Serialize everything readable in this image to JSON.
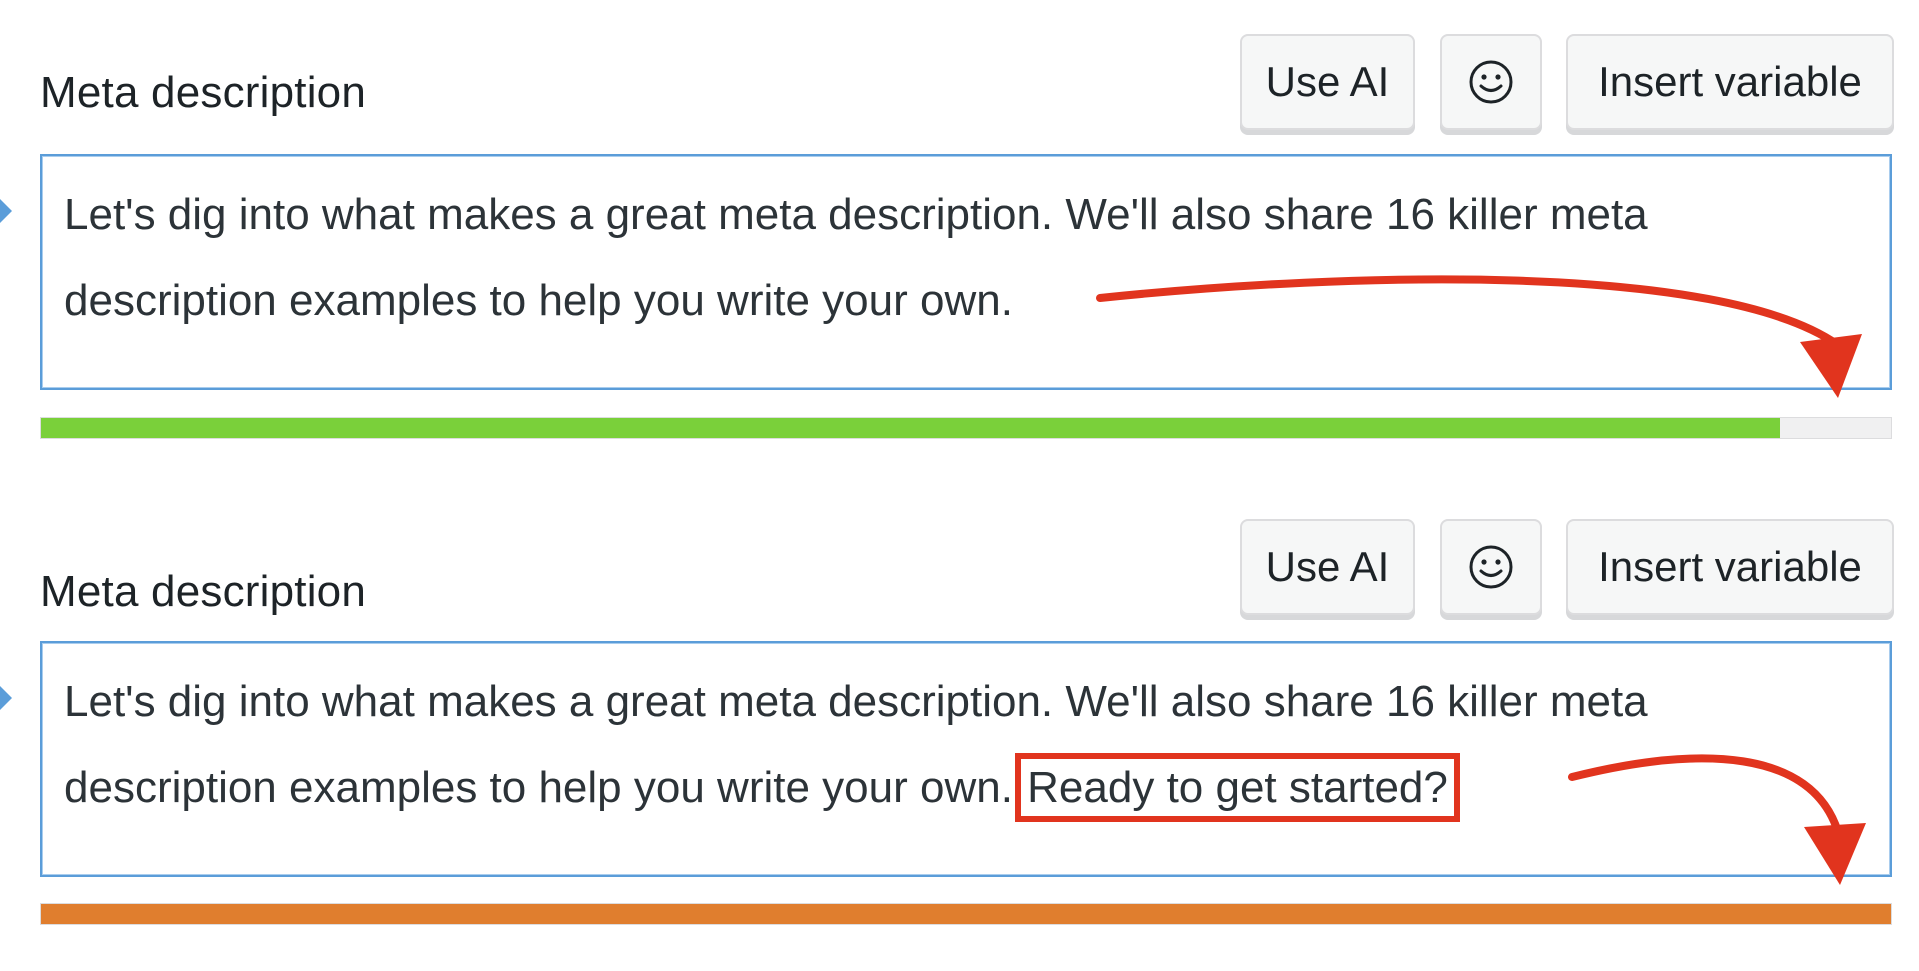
{
  "fields": [
    {
      "label": "Meta description",
      "buttons": {
        "use_ai": "Use AI",
        "emoji_icon": "smiley-icon",
        "insert_variable": "Insert variable"
      },
      "text": "Let's dig into what makes a great meta description. We'll also share 16 killer meta description examples to help you write your own.",
      "highlighted_text": "",
      "progress": {
        "fraction": 0.94,
        "color": "#7ad03a"
      }
    },
    {
      "label": "Meta description",
      "buttons": {
        "use_ai": "Use AI",
        "emoji_icon": "smiley-icon",
        "insert_variable": "Insert variable"
      },
      "text": "Let's dig into what makes a great meta description. We'll also share 16 killer meta description examples to help you write your own.",
      "highlighted_text": "Ready to get started?",
      "progress": {
        "fraction": 1.0,
        "color": "#e07e2e"
      }
    }
  ],
  "colors": {
    "annotation_red": "#e1341e",
    "focus_border": "#5b9dd9"
  }
}
